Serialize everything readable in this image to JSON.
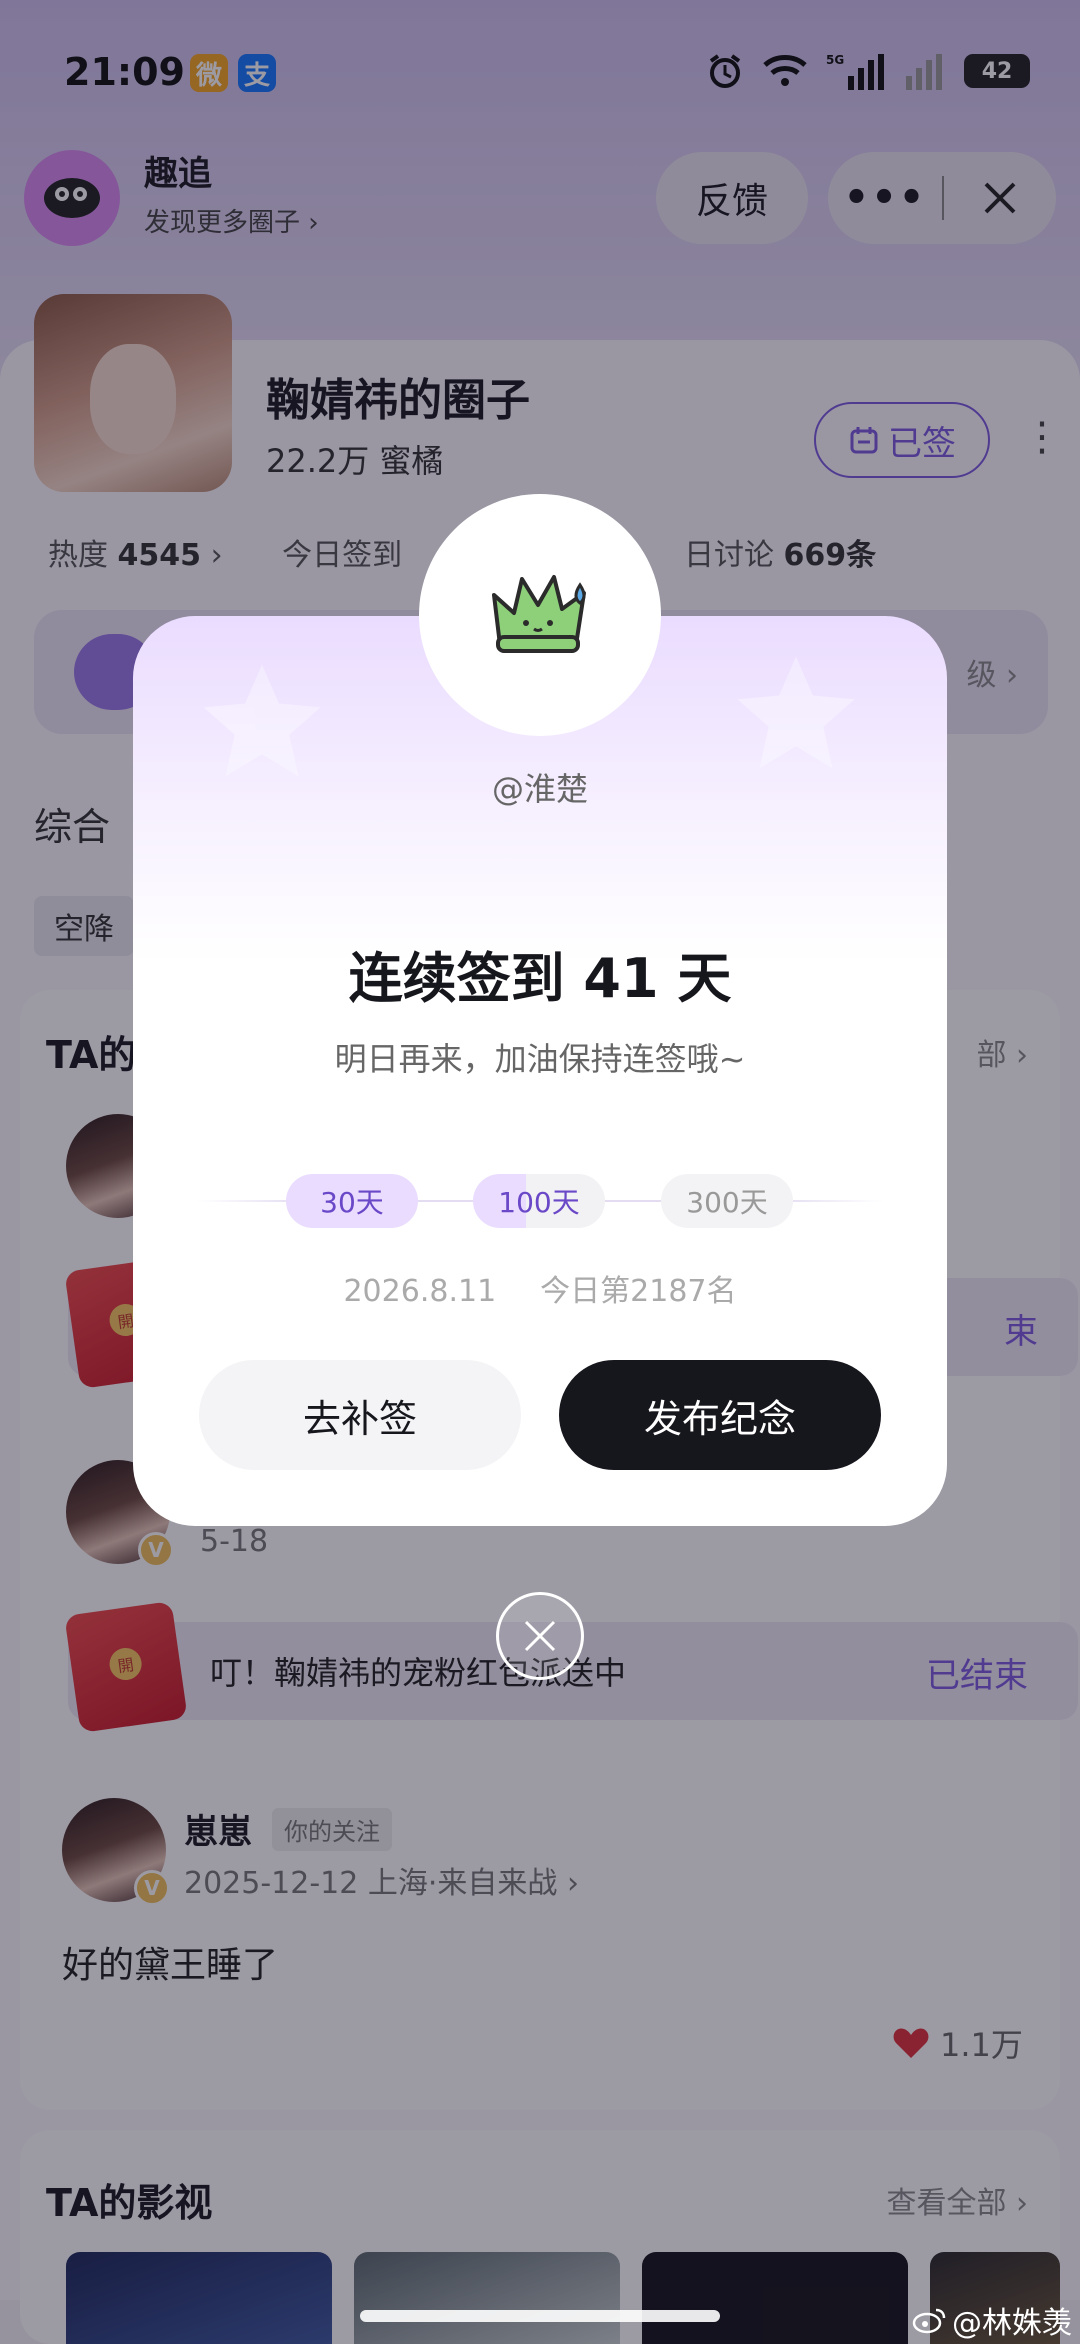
{
  "status_bar": {
    "time": "21:09",
    "battery": "42",
    "network": "5G"
  },
  "mini_app": {
    "name": "趣追",
    "subtitle": "发现更多圈子",
    "feedback_label": "反馈",
    "more_label": "•••"
  },
  "circle": {
    "name": "鞠婧祎的圈子",
    "fans": "22.2万 蜜橘",
    "signed_label": "已签",
    "heat_label": "热度",
    "heat_value": "4545",
    "today_sign_label": "今日签到",
    "discuss_label": "日讨论",
    "discuss_value": "669条",
    "level_right": "级"
  },
  "page": {
    "tab_label": "综合",
    "chip_label": "空降",
    "section_title": "TA的",
    "section_more": "部",
    "post1_date": "5-18",
    "redpack_text": "叮！鞠婧祎的宠粉红包派送中",
    "redpack_status": "已结束",
    "redpack_status_partial": "束",
    "post2": {
      "name": "崽崽",
      "tag": "你的关注",
      "meta": "2025-12-12 上海·来自来战",
      "text": "好的黛王睡了",
      "likes": "1.1万"
    },
    "films_title": "TA的影视",
    "films_more": "查看全部"
  },
  "dialog": {
    "handle": "@淮楚",
    "streak": "连续签到 41 天",
    "subtitle": "明日再来，加油保持连签哦~",
    "milestones": [
      "30天",
      "100天",
      "300天"
    ],
    "date": "2026.8.11",
    "rank": "今日第2187名",
    "makeup_label": "去补签",
    "publish_label": "发布纪念"
  },
  "watermark": "@林姝羡",
  "colors": {
    "accent": "#7c5ce0",
    "dark_button": "#16161d",
    "milestone_bg": "#e9dcff"
  },
  "icons": [
    "weibo-icon",
    "alipay-icon",
    "alarm-icon",
    "wifi-icon",
    "signal-icon",
    "calendar-icon",
    "heart-icon",
    "close-icon",
    "chevron-right-icon"
  ]
}
